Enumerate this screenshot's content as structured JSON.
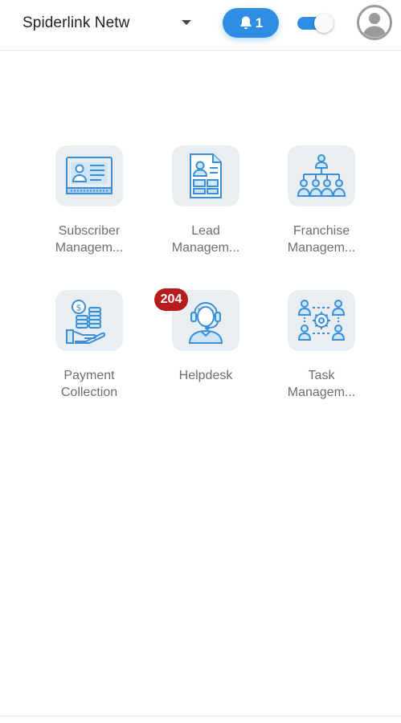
{
  "header": {
    "org_name": "Spiderlink Netw",
    "notification_count": "1",
    "toggle_on": true
  },
  "modules": [
    {
      "label": "Subscriber\nManagem...",
      "icon": "subscriber-card-icon"
    },
    {
      "label": "Lead\nManagem...",
      "icon": "lead-document-icon"
    },
    {
      "label": "Franchise\nManagem...",
      "icon": "franchise-hierarchy-icon"
    },
    {
      "label": "Payment\nCollection",
      "icon": "payment-hand-coins-icon"
    },
    {
      "label": "Helpdesk",
      "icon": "helpdesk-agent-icon",
      "badge": "204"
    },
    {
      "label": "Task\nManagem...",
      "icon": "task-team-gear-icon"
    }
  ],
  "colors": {
    "accent": "#2f8de6",
    "badge": "#b71c1c",
    "icon_stroke": "#3b8fd9",
    "tile_bg": "#e9eef2"
  }
}
